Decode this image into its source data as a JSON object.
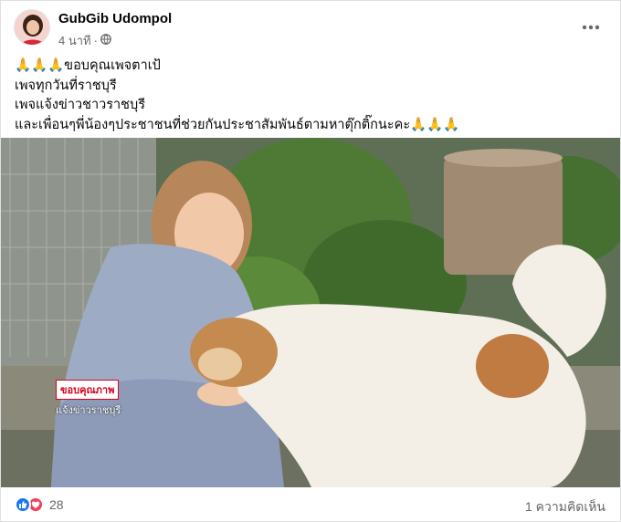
{
  "post": {
    "author": "GubGib Udompol",
    "time": "4 นาที",
    "separator": "·",
    "privacy_icon": "globe-icon",
    "more_icon": "ellipsis-icon",
    "lines": [
      "🙏🙏🙏ขอบคุณเพจตาเป้",
      "เพจทุกวันที่ราชบุรี",
      "เพจแจ้งข่าวชาวราชบุรี",
      "และเพื่อนๆพี่น้องๆประชาชนที่ช่วยกันประชาสัมพันธ์ตามหาตุ๊กติ๊กนะคะ🙏🙏🙏"
    ]
  },
  "media": {
    "overlay_title": "ขอบคุณภาพ",
    "overlay_source": "แจ้งข่าวราชบุรี"
  },
  "footer": {
    "reaction_icons": [
      "like-icon",
      "love-icon"
    ],
    "reaction_count": "28",
    "comments": "1 ความคิดเห็น"
  },
  "colors": {
    "secondary_text": "#65676b",
    "like": "#1877f2",
    "love": "#f33e58"
  }
}
